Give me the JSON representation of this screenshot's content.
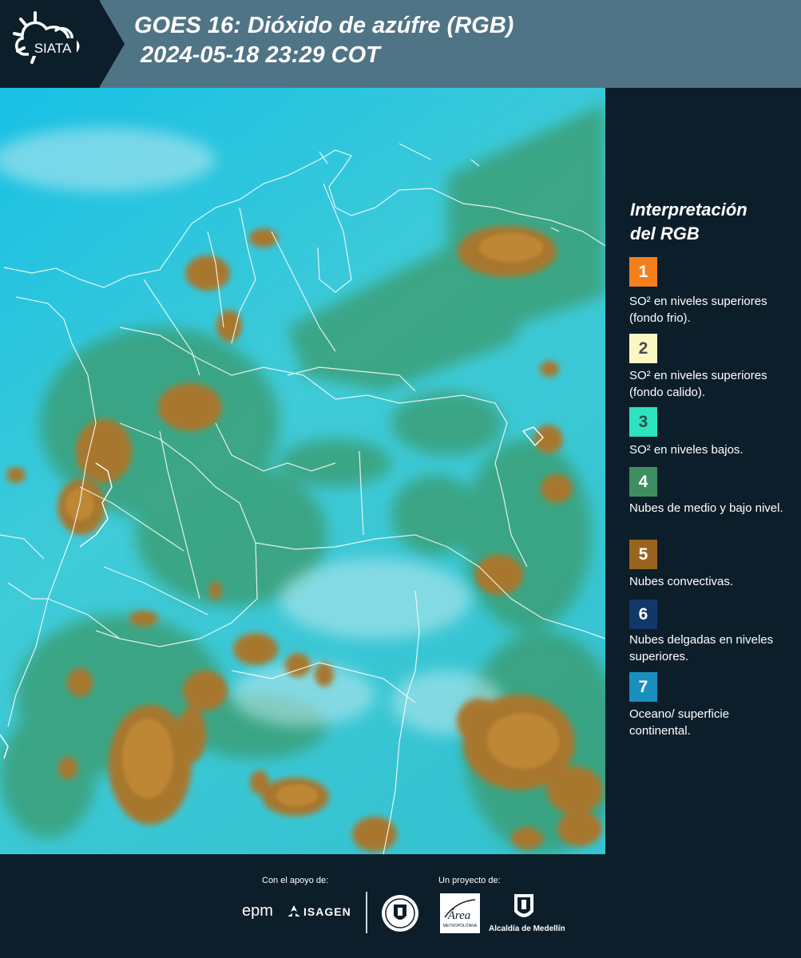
{
  "header": {
    "title": "GOES 16: Dióxido de azúfre (RGB)\n 2024-05-18 23:29 COT",
    "logo_text": "SIATA"
  },
  "legend": {
    "title": "Interpretación\ndel RGB",
    "items": [
      {
        "number": "1",
        "color": "#f57f1c",
        "text_color": "#ffffff",
        "label": "SO² en niveles superiores (fondo frio)."
      },
      {
        "number": "2",
        "color": "#fdf7c3",
        "text_color": "#4a4a4a",
        "label": "SO² en niveles superiores (fondo calido)."
      },
      {
        "number": "3",
        "color": "#2ee3bf",
        "text_color": "#2f4f4a",
        "label": "SO² en niveles bajos."
      },
      {
        "number": "4",
        "color": "#3d8f62",
        "text_color": "#ffffff",
        "label": "Nubes de medio y bajo nivel."
      },
      {
        "number": "5",
        "color": "#9a6420",
        "text_color": "#ffffff",
        "label": "Nubes convectivas."
      },
      {
        "number": "6",
        "color": "#12386a",
        "text_color": "#ffffff",
        "label": "Nubes delgadas en niveles superiores."
      },
      {
        "number": "7",
        "color": "#1a8fbf",
        "text_color": "#ffffff",
        "label": "Oceano/ superficie continental."
      }
    ]
  },
  "footer": {
    "support_label": "Con el apoyo de:",
    "project_label": "Un proyecto de:",
    "sponsor_epm": "epm",
    "sponsor_isagen": "ISAGEN",
    "area_logo_text": "Área",
    "area_caption": "METROPOLITANA",
    "alcaldia_label": "Alcaldía de Medellín"
  },
  "map_colors": {
    "cyan_background": "#2fc6dd",
    "convective_brown": "#a8772d",
    "mid_low_green": "#3b9a6a",
    "borders": "#ffffff"
  }
}
